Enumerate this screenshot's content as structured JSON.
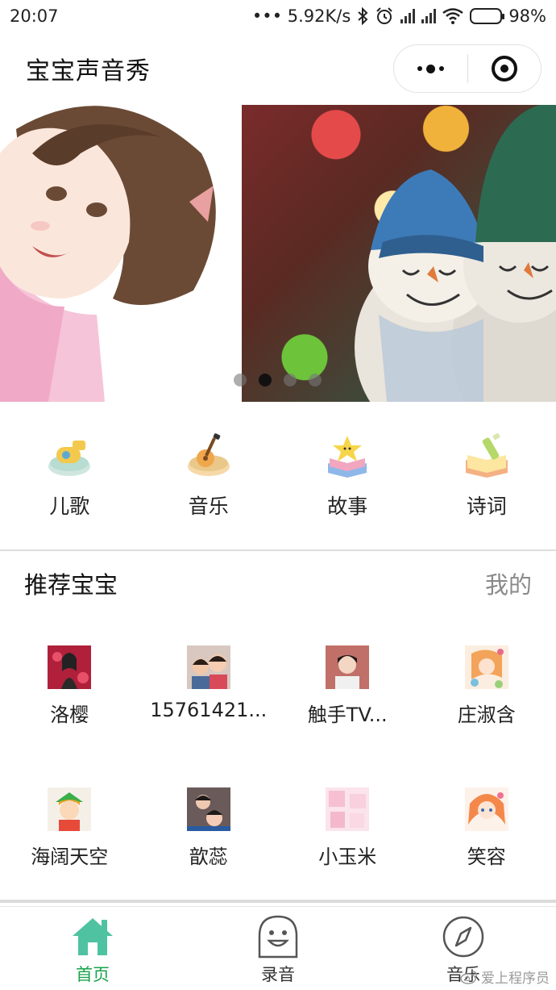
{
  "status_bar": {
    "time": "20:07",
    "network_speed": "••• 5.92K/s",
    "battery": "98%"
  },
  "header": {
    "title": "宝宝声音秀"
  },
  "banner": {
    "slides": [
      "girl-illustration",
      "snowmen-photo"
    ],
    "active_index": 1,
    "dot_count": 4
  },
  "categories": [
    {
      "label": "儿歌",
      "icon": "whistle-icon"
    },
    {
      "label": "音乐",
      "icon": "guitar-icon"
    },
    {
      "label": "故事",
      "icon": "storybook-icon"
    },
    {
      "label": "诗词",
      "icon": "poetry-book-icon"
    }
  ],
  "recommend": {
    "title": "推荐宝宝",
    "more": "我的",
    "babies": [
      {
        "name": "洛樱"
      },
      {
        "name": "15761421..."
      },
      {
        "name": "触手TV..."
      },
      {
        "name": "庄淑含"
      },
      {
        "name": "海阔天空"
      },
      {
        "name": "歆蕊"
      },
      {
        "name": "小玉米"
      },
      {
        "name": "笑容"
      }
    ]
  },
  "tabbar": {
    "items": [
      {
        "label": "首页",
        "icon": "home-icon",
        "active": true
      },
      {
        "label": "录音",
        "icon": "smile-mic-icon",
        "active": false
      },
      {
        "label": "音乐",
        "icon": "compass-icon",
        "active": false
      }
    ]
  },
  "watermark": "爱上程序员",
  "colors": {
    "accent": "#17a34a",
    "home_icon": "#4fc3a1"
  }
}
